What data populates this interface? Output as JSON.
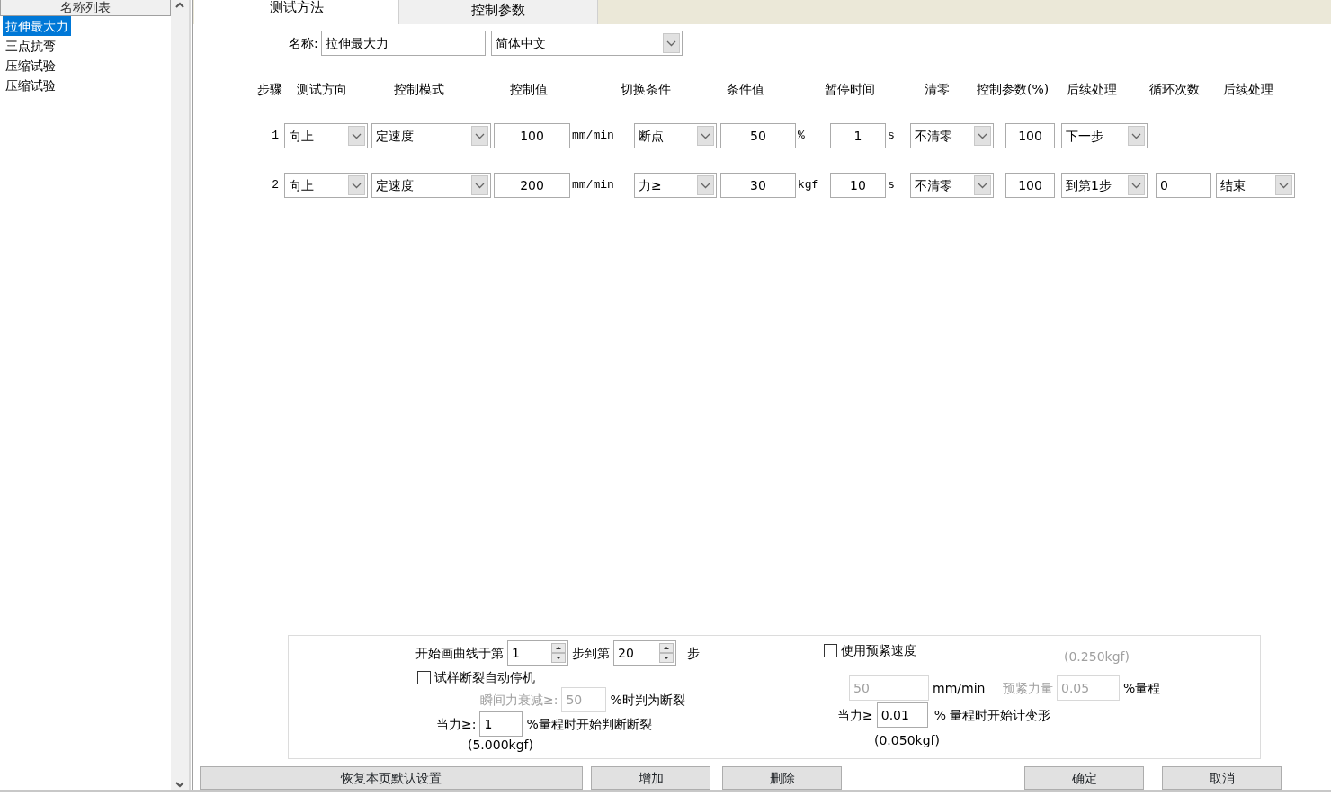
{
  "sidebar": {
    "header": "名称列表",
    "items": [
      {
        "label": "拉伸最大力",
        "selected": true
      },
      {
        "label": "三点抗弯",
        "selected": false
      },
      {
        "label": "压缩试验",
        "selected": false
      },
      {
        "label": "压缩试验",
        "selected": false
      }
    ]
  },
  "tabs": [
    {
      "label": "测试方法",
      "selected": true
    },
    {
      "label": "控制参数",
      "selected": false
    }
  ],
  "name_row": {
    "label": "名称:",
    "value": "拉伸最大力",
    "language": "简体中文"
  },
  "steps_table": {
    "columns": [
      "步骤",
      "测试方向",
      "控制模式",
      "控制值",
      "切换条件",
      "条件值",
      "暂停时间",
      "清零",
      "控制参数(%)",
      "后续处理",
      "循环次数",
      "后续处理"
    ],
    "rows": [
      {
        "step": "1",
        "direction": "向上",
        "mode": "定速度",
        "control_value": "100",
        "control_unit": "mm/min",
        "switch_condition": "断点",
        "condition_value": "50",
        "condition_unit": "%",
        "pause": "1",
        "pause_unit": "s",
        "clear": "不清零",
        "control_param": "100",
        "post_processing": "下一步"
      },
      {
        "step": "2",
        "direction": "向上",
        "mode": "定速度",
        "control_value": "200",
        "control_unit": "mm/min",
        "switch_condition": "力≥",
        "condition_value": "30",
        "condition_unit": "kgf",
        "pause": "10",
        "pause_unit": "s",
        "clear": "不清零",
        "control_param": "100",
        "post_processing": "到第1步",
        "loop_count": "0",
        "post_processing_2": "结束"
      }
    ]
  },
  "curve_settings": {
    "draw_curve": {
      "label_before": "开始画曲线于第",
      "from": "1",
      "label_mid": "步到第",
      "to": "20",
      "label_after": "步"
    },
    "auto_stop": {
      "label": "试样断裂自动停机",
      "checked": false
    },
    "break_drop": {
      "label": "瞬间力衰减≥:",
      "value": "50",
      "suffix": "%时判为断裂",
      "disabled": true
    },
    "break_force": {
      "label": "当力≥:",
      "value": "1",
      "suffix": "%量程时开始判断断裂",
      "note": "(5.000kgf)"
    },
    "preload": {
      "label": "使用预紧速度",
      "checked": false
    },
    "preload_note": {
      "text": "(0.250kgf)",
      "disabled": true
    },
    "preload_speed": {
      "value": "50",
      "unit": "mm/min",
      "disabled": true
    },
    "preload_force": {
      "label": "预紧力量",
      "value": "0.05",
      "suffix": "%量程",
      "disabled": true
    },
    "deform_force": {
      "label": "当力≥",
      "value": "0.01",
      "suffix": "% 量程时开始计变形",
      "note": "(0.050kgf)"
    }
  },
  "buttons": [
    "恢复本页默认设置",
    "增加",
    "删除",
    "确定",
    "取消"
  ]
}
